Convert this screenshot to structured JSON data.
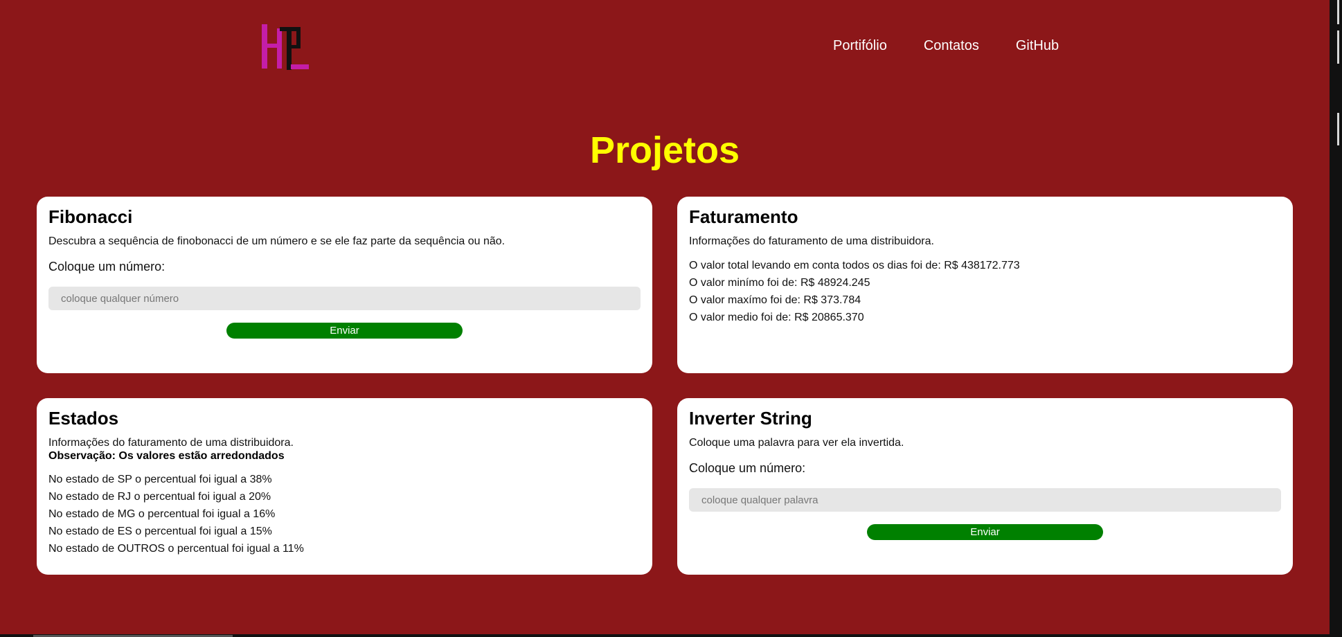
{
  "nav": {
    "items": [
      "Portifólio",
      "Contatos",
      "GitHub"
    ]
  },
  "section": {
    "title": "Projetos"
  },
  "fibonacci": {
    "title": "Fibonacci",
    "description": "Descubra a sequência de finobonacci de um número e se ele faz parte da sequência ou não.",
    "prompt": "Coloque um número:",
    "placeholder": "coloque qualquer número",
    "button": "Enviar"
  },
  "faturamento": {
    "title": "Faturamento",
    "description": "Informações do faturamento de uma distribuidora.",
    "lines": [
      "O valor total levando em conta todos os dias foi de: R$ 438172.773",
      "O valor minímo foi de: R$ 48924.245",
      "O valor maxímo foi de: R$ 373.784",
      "O valor medio foi de: R$ 20865.370"
    ]
  },
  "estados": {
    "title": "Estados",
    "description": "Informações do faturamento de uma distribuidora.",
    "note": "Observação: Os valores estão arredondados",
    "lines": [
      "No estado de SP o percentual foi igual a 38%",
      "No estado de RJ o percentual foi igual a 20%",
      "No estado de MG o percentual foi igual a 16%",
      "No estado de ES o percentual foi igual a 15%",
      "No estado de OUTROS o percentual foi igual a 11%"
    ]
  },
  "inverter": {
    "title": "Inverter String",
    "description": "Coloque uma palavra para ver ela invertida.",
    "prompt": "Coloque um número:",
    "placeholder": "coloque qualquer palavra",
    "button": "Enviar"
  },
  "colors": {
    "background": "#8c1719",
    "title": "#ffff00",
    "button": "#008000",
    "logo": "#c41ea8"
  }
}
